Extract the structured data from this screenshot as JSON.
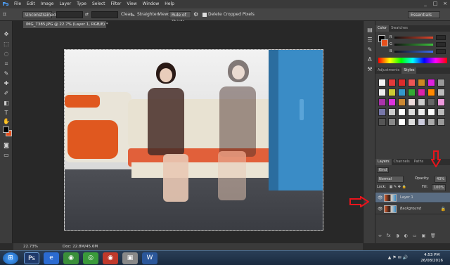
{
  "app": {
    "logo": "Ps"
  },
  "menu": [
    "File",
    "Edit",
    "Image",
    "Layer",
    "Type",
    "Select",
    "Filter",
    "View",
    "Window",
    "Help"
  ],
  "window_controls": [
    "_",
    "□",
    "×"
  ],
  "options_bar": {
    "ratio_dropdown": "Unconstrained",
    "swap_icon": "⇄",
    "clear_label": "Clear",
    "straighten_label": "Straighten",
    "view_label": "View:",
    "view_dropdown": "Rule of Thirds",
    "delete_cropped_label": "Delete Cropped Pixels",
    "workspace_dropdown": "Essentials"
  },
  "document": {
    "tab_title": "IMG_7385.JPG @ 22.7% (Layer 1, RGB/8) *",
    "zoom": "22.73%",
    "doc_info": "Doc: 22.8M/45.6M"
  },
  "color_panel": {
    "tabs": [
      "Color",
      "Swatches"
    ],
    "channels": [
      {
        "label": "R",
        "value": "",
        "color": "#e0452a"
      },
      {
        "label": "G",
        "value": "",
        "color": "#3cc03c"
      },
      {
        "label": "B",
        "value": "",
        "color": "#3c6cf0"
      }
    ]
  },
  "styles_panel": {
    "tabs": [
      "Adjustments",
      "Styles"
    ],
    "swatch_colors": [
      "#f4f4f4",
      "#e33a3a",
      "#dd2b2b",
      "#e55",
      "#c82",
      "#d2d",
      "#999",
      "#eee",
      "#cc3",
      "#39c",
      "#3a3",
      "#d2a",
      "#f80",
      "#bbb",
      "#a3a",
      "#d3d",
      "#c83",
      "#edd",
      "#ccc",
      "#666",
      "#e9d",
      "#77a",
      "#ccc",
      "#fff",
      "#ddd",
      "#eee",
      "#fff",
      "#bbb",
      "#555",
      "#888",
      "#fff",
      "#ddd",
      "#ccd",
      "#aaa",
      "#999"
    ]
  },
  "layers_panel": {
    "tabs": [
      "Layers",
      "Channels",
      "Paths"
    ],
    "kind_label": "Kind",
    "blend_mode": "Normal",
    "opacity_label": "Opacity:",
    "opacity_value": "43%",
    "lock_label": "Lock:",
    "fill_label": "Fill:",
    "fill_value": "100%",
    "layers": [
      {
        "name": "Layer 1",
        "visible": true,
        "locked": false
      },
      {
        "name": "Background",
        "visible": true,
        "locked": true
      }
    ],
    "arrow_color": "#e8141c"
  },
  "taskbar": {
    "time": "4:53 PM",
    "date": "26/08/2016",
    "apps": [
      {
        "label": "Ps",
        "color": "#1f3a6a"
      },
      {
        "label": "e",
        "color": "#2b6bd1"
      },
      {
        "label": "◉",
        "color": "#3a8f3a"
      },
      {
        "label": "◎",
        "color": "#3a9a3a"
      },
      {
        "label": "◉",
        "color": "#c0392b"
      },
      {
        "label": "▣",
        "color": "#888"
      },
      {
        "label": "W",
        "color": "#2b579a"
      }
    ]
  }
}
